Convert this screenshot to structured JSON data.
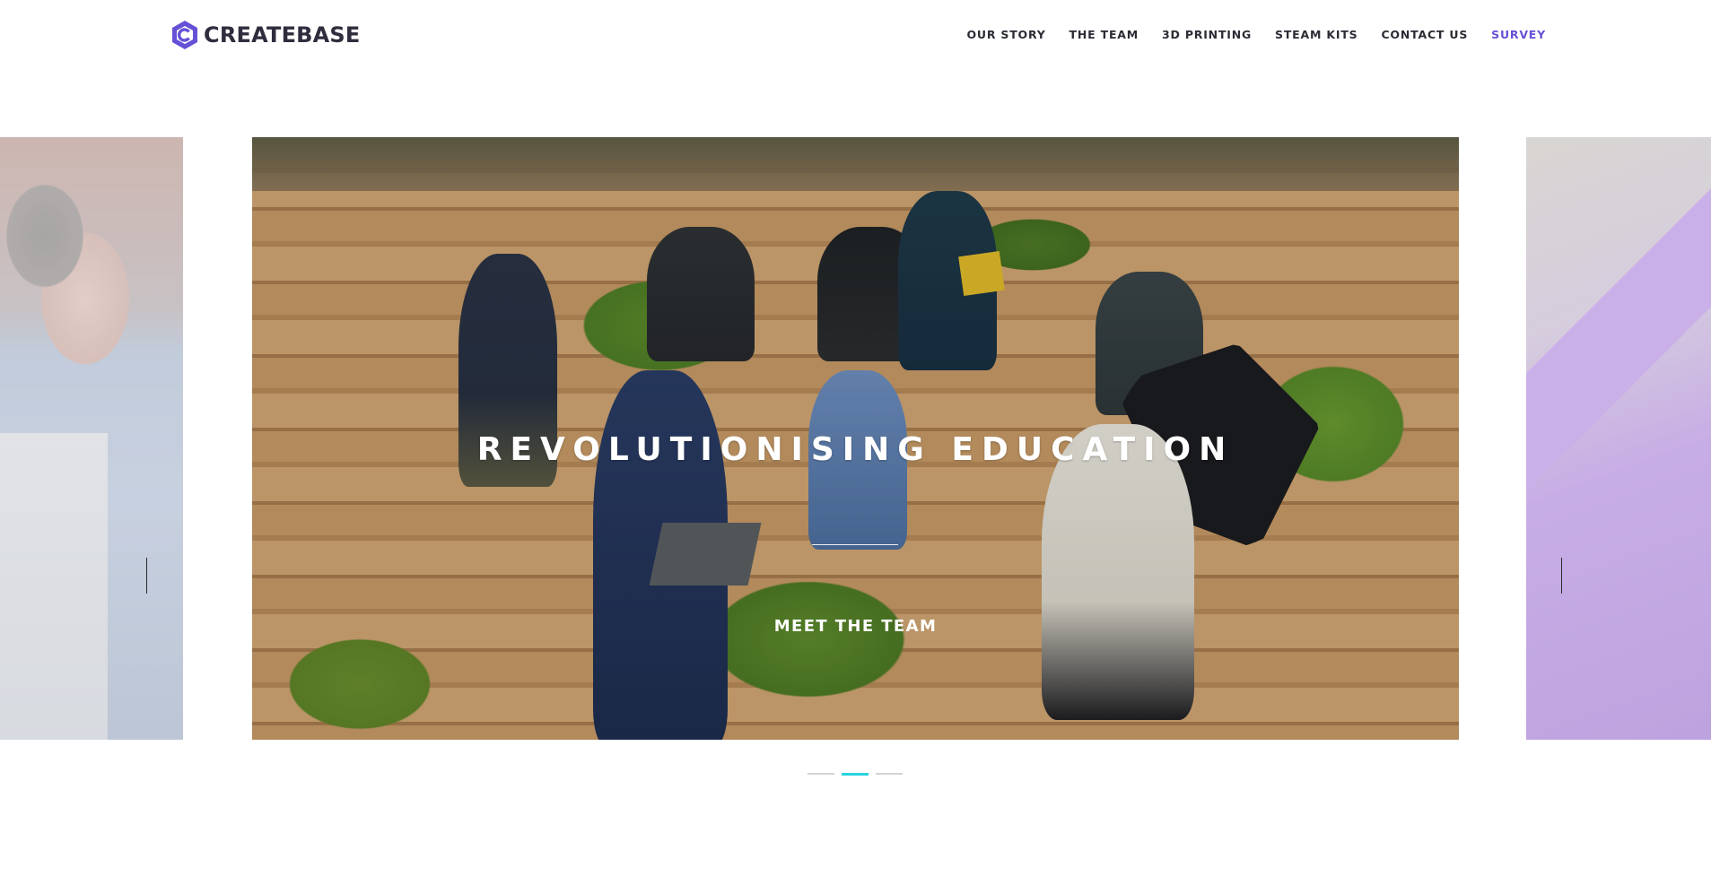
{
  "brand": {
    "name": "CREATEBASE",
    "logo_icon": "hexagon-c-logo-icon",
    "logo_color": "#6451d6"
  },
  "nav": {
    "items": [
      {
        "label": "OUR STORY"
      },
      {
        "label": "THE TEAM"
      },
      {
        "label": "3D PRINTING"
      },
      {
        "label": "STEAM KITS"
      },
      {
        "label": "CONTACT US"
      },
      {
        "label": "SURVEY"
      }
    ],
    "active_color": "#6451d6"
  },
  "carousel": {
    "title": "REVOLUTIONISING EDUCATION",
    "link_label": "MEET THE TEAM",
    "active_index": 1,
    "slide_count": 3,
    "active_dot_color": "#29d3e0"
  }
}
